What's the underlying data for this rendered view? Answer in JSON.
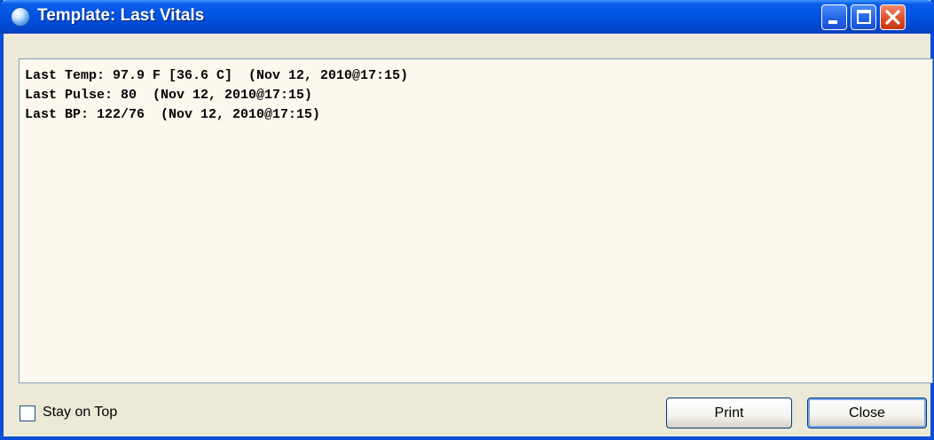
{
  "window": {
    "title": "Template: Last Vitals",
    "buttons": [
      "minimize",
      "maximize",
      "close"
    ]
  },
  "vitals": {
    "lines": [
      "Last Temp: 97.9 F [36.6 C]  (Nov 12, 2010@17:15)",
      "Last Pulse: 80  (Nov 12, 2010@17:15)",
      "Last BP: 122/76  (Nov 12, 2010@17:15)"
    ]
  },
  "footer": {
    "stay_on_top_label": "Stay on Top",
    "stay_on_top_checked": false,
    "print_label": "Print",
    "close_label": "Close"
  },
  "colors": {
    "titlebar": "#0054e3",
    "content_background": "#fdf8ee",
    "close_button": "#e0502b"
  }
}
